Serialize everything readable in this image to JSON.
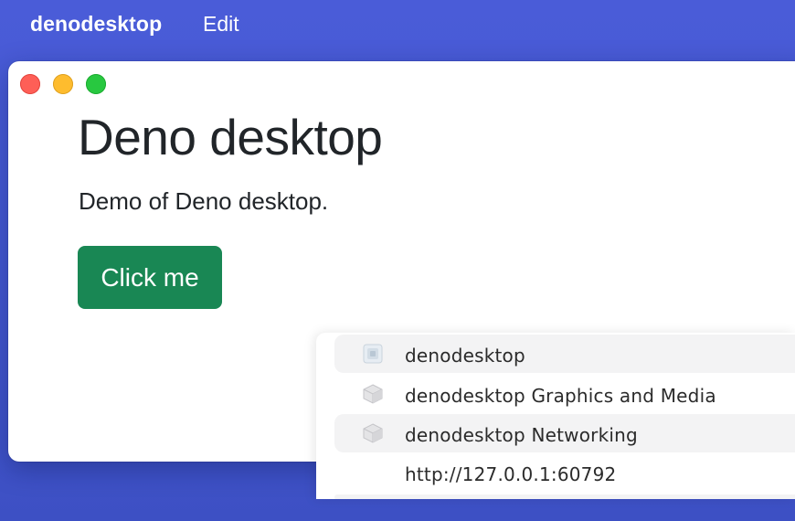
{
  "menubar": {
    "app_name": "denodesktop",
    "edit_label": "Edit"
  },
  "window": {
    "title": "Deno desktop",
    "subtitle": "Demo of Deno desktop.",
    "button_label": "Click me"
  },
  "popup": {
    "items": [
      {
        "label": "denodesktop",
        "icon": "app-icon"
      },
      {
        "label": "denodesktop Graphics and Media",
        "icon": "package-icon"
      },
      {
        "label": "denodesktop Networking",
        "icon": "package-icon"
      },
      {
        "label": "http://127.0.0.1:60792",
        "icon": ""
      }
    ]
  },
  "colors": {
    "desktop_background": "#4356cf",
    "button_background": "#198754",
    "traffic_close": "#fe5f57",
    "traffic_minimize": "#febc2e",
    "traffic_zoom": "#28c840"
  }
}
